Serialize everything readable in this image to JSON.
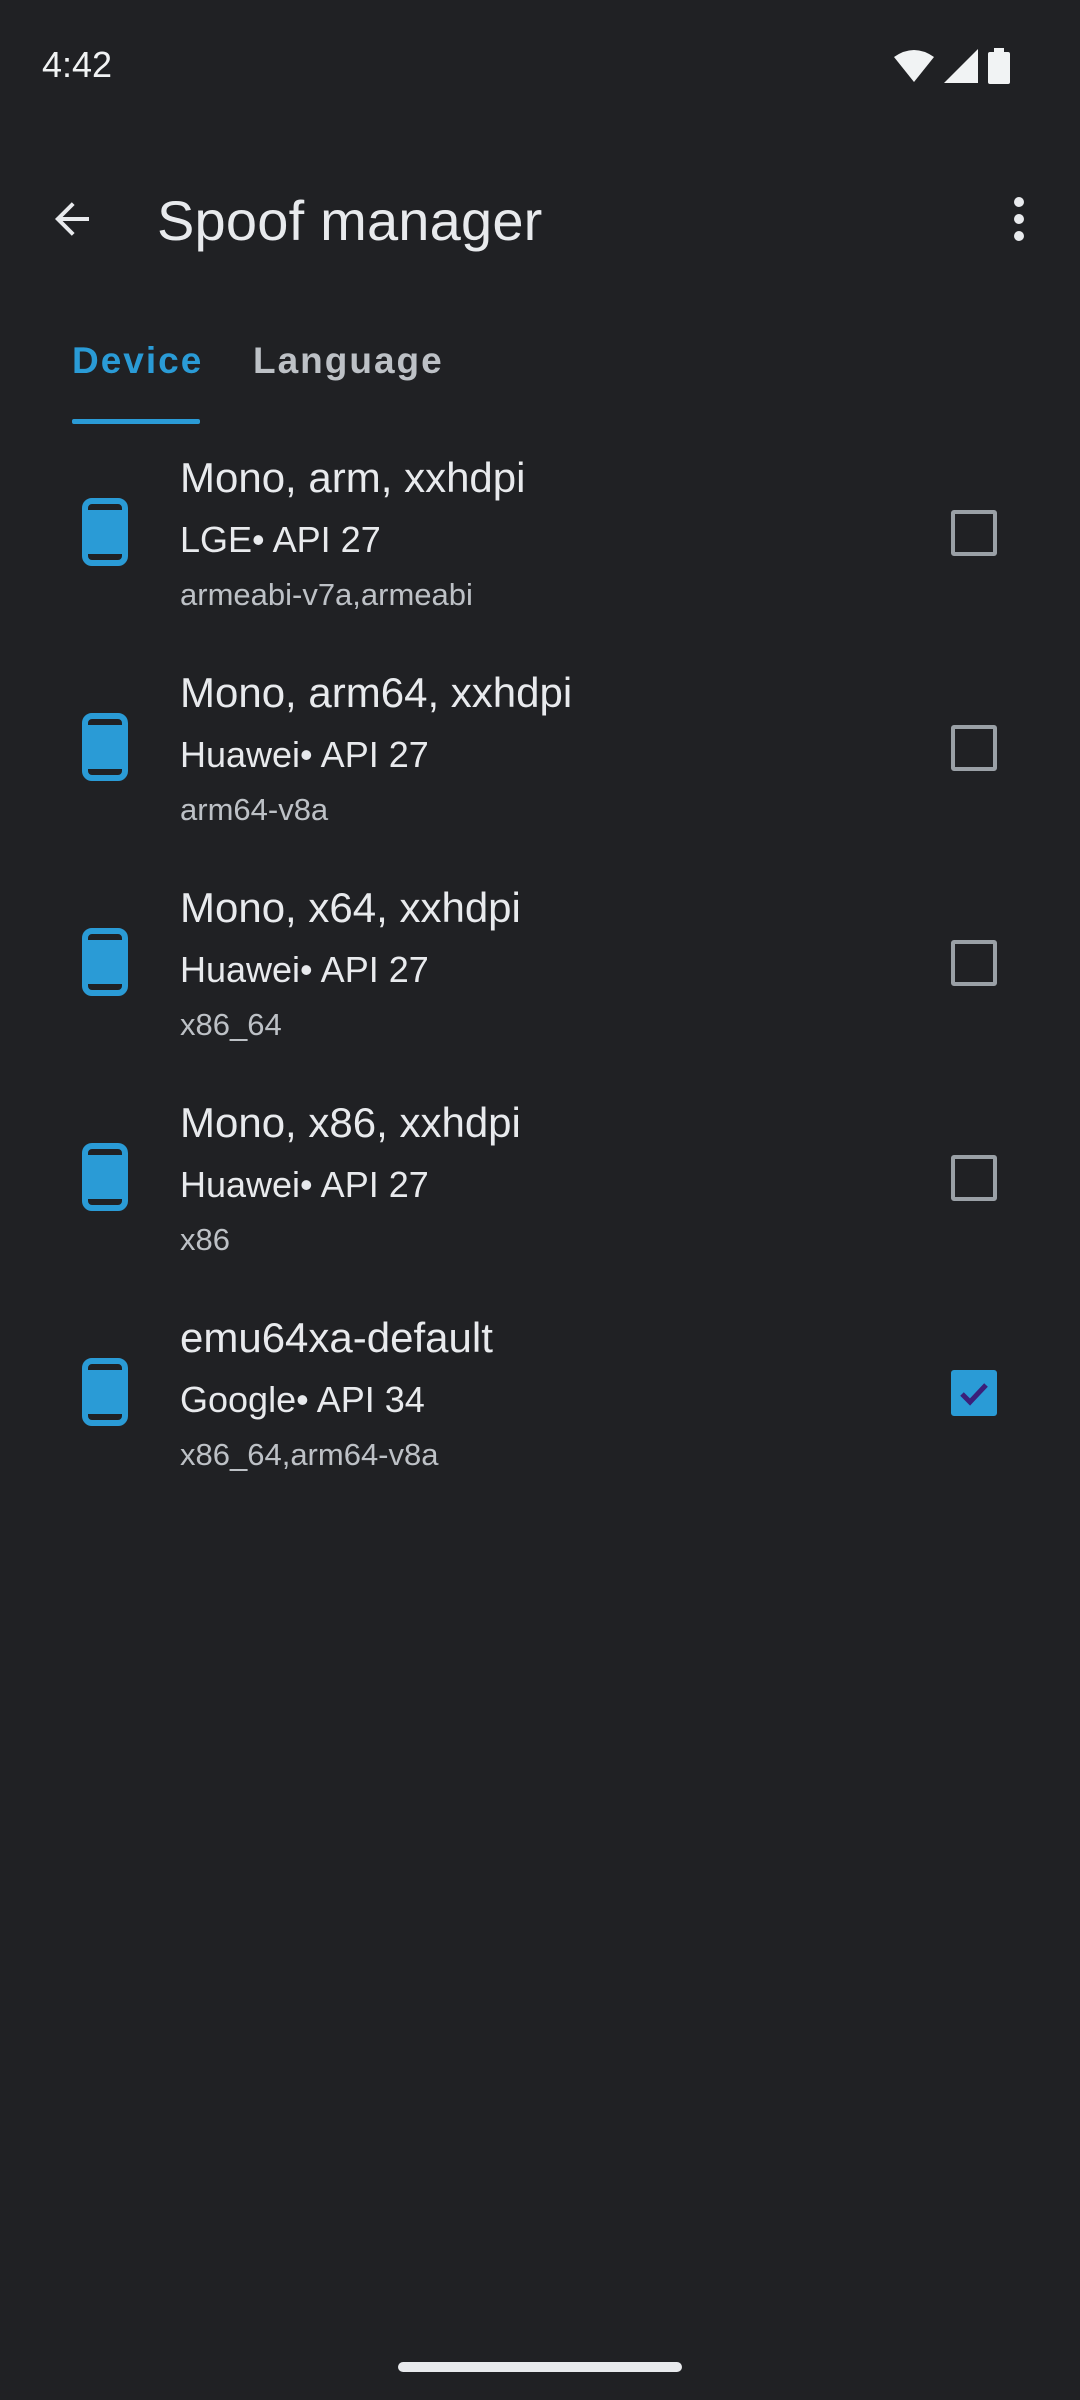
{
  "status_bar": {
    "time": "4:42",
    "icons": [
      "wifi-icon",
      "cellular-signal-icon",
      "battery-icon"
    ]
  },
  "app_bar": {
    "title": "Spoof manager",
    "back_icon": "arrow-back-icon",
    "overflow_icon": "more-vert-icon"
  },
  "tabs": [
    {
      "label": "Device",
      "selected": true
    },
    {
      "label": "Language",
      "selected": false
    }
  ],
  "devices": [
    {
      "name": "Mono, arm, xxhdpi",
      "meta": "LGE• API 27",
      "abi": "armeabi-v7a,armeabi",
      "checked": false,
      "icon": "smartphone-icon"
    },
    {
      "name": "Mono, arm64, xxhdpi",
      "meta": "Huawei• API 27",
      "abi": "arm64-v8a",
      "checked": false,
      "icon": "smartphone-icon"
    },
    {
      "name": "Mono, x64, xxhdpi",
      "meta": "Huawei• API 27",
      "abi": "x86_64",
      "checked": false,
      "icon": "smartphone-icon"
    },
    {
      "name": "Mono, x86, xxhdpi",
      "meta": "Huawei• API 27",
      "abi": "x86",
      "checked": false,
      "icon": "smartphone-icon"
    },
    {
      "name": "emu64xa-default",
      "meta": "Google• API 34",
      "abi": "x86_64,arm64-v8a",
      "checked": true,
      "icon": "smartphone-icon"
    }
  ],
  "colors": {
    "background": "#202124",
    "accent": "#2a9bd6",
    "text_primary": "#e8eaed",
    "text_secondary": "#bdc1c6"
  }
}
